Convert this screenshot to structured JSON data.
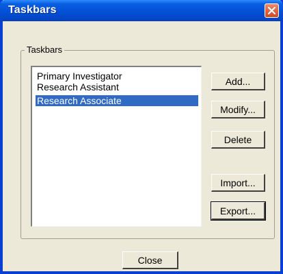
{
  "window": {
    "title": "Taskbars"
  },
  "group": {
    "label": "Taskbars"
  },
  "list": {
    "items": [
      {
        "label": "Primary Investigator",
        "selected": false
      },
      {
        "label": "Research Assistant",
        "selected": false
      },
      {
        "label": "Research Associate",
        "selected": true
      }
    ]
  },
  "buttons": {
    "add": "Add...",
    "modify": "Modify...",
    "delete": "Delete",
    "import": "Import...",
    "export": "Export...",
    "close": "Close"
  },
  "icons": {
    "close": "close-x-icon"
  },
  "colors": {
    "selection": "#316ac5",
    "titlebar": "#0452d8",
    "close_button": "#e06a45"
  }
}
